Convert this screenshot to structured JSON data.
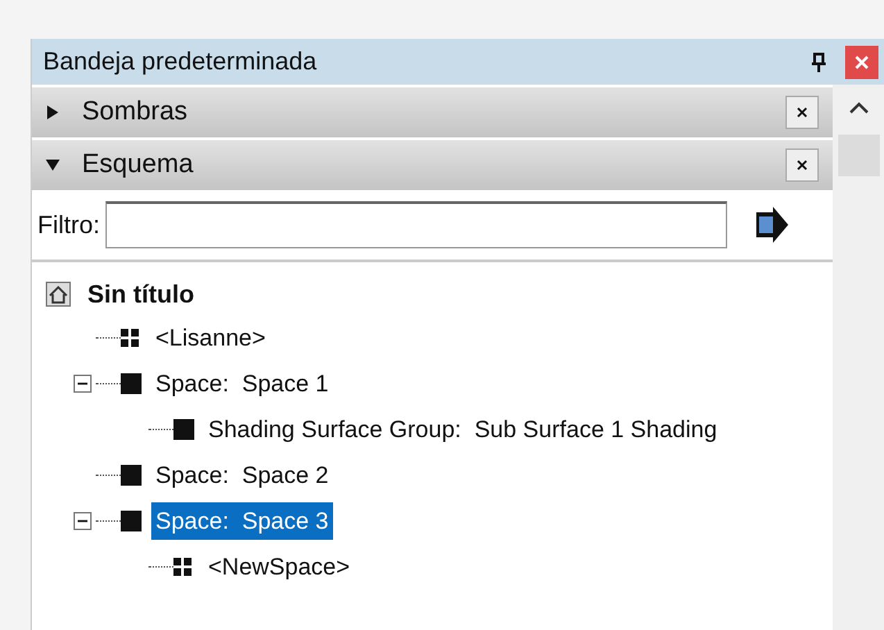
{
  "window": {
    "title": "Bandeja predeterminada"
  },
  "sections": [
    {
      "title": "Sombras",
      "expanded": false
    },
    {
      "title": "Esquema",
      "expanded": true
    }
  ],
  "filter": {
    "label": "Filtro:"
  },
  "tree": {
    "label": "Sin título",
    "children": [
      {
        "label": "<Lisanne>",
        "kind": "group",
        "selected": false
      },
      {
        "label": "Space:  Space 1",
        "kind": "space",
        "selected": false,
        "expanded": true,
        "children": [
          {
            "label": "Shading Surface Group:  Sub Surface 1 Shading",
            "kind": "space",
            "selected": false
          }
        ]
      },
      {
        "label": "Space:  Space 2",
        "kind": "space",
        "selected": false
      },
      {
        "label": "Space:  Space 3",
        "kind": "space",
        "selected": true,
        "expanded": true,
        "children": [
          {
            "label": "<NewSpace>",
            "kind": "group",
            "selected": false
          }
        ]
      }
    ]
  }
}
